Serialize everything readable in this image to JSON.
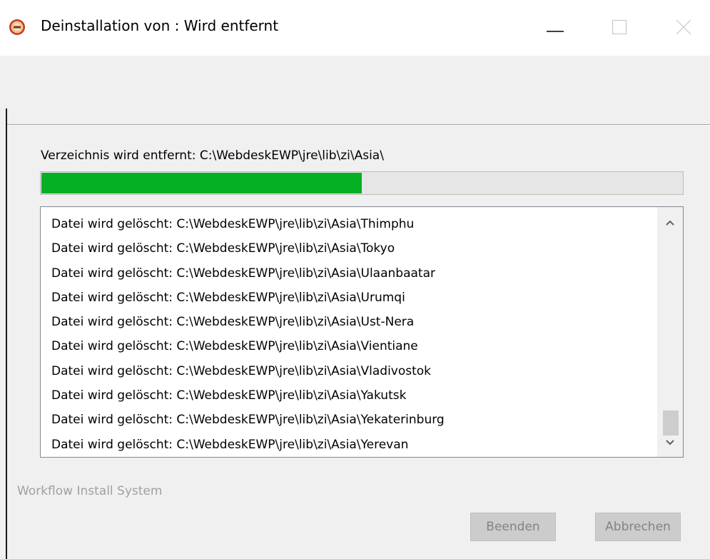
{
  "window": {
    "title": "Deinstallation von : Wird entfernt",
    "icon": "installer-app-icon"
  },
  "titlebar_controls": {
    "minimize_icon": "minimize-icon",
    "maximize_icon": "maximize-icon",
    "close_icon": "close-icon"
  },
  "status": {
    "label": "Verzeichnis wird entfernt: C:\\WebdeskEWP\\jre\\lib\\zi\\Asia\\",
    "progress": 0.5,
    "progress_color": "#06b025"
  },
  "log": {
    "items": [
      "Datei wird gelöscht: C:\\WebdeskEWP\\jre\\lib\\zi\\Asia\\Thimphu",
      "Datei wird gelöscht: C:\\WebdeskEWP\\jre\\lib\\zi\\Asia\\Tokyo",
      "Datei wird gelöscht: C:\\WebdeskEWP\\jre\\lib\\zi\\Asia\\Ulaanbaatar",
      "Datei wird gelöscht: C:\\WebdeskEWP\\jre\\lib\\zi\\Asia\\Urumqi",
      "Datei wird gelöscht: C:\\WebdeskEWP\\jre\\lib\\zi\\Asia\\Ust-Nera",
      "Datei wird gelöscht: C:\\WebdeskEWP\\jre\\lib\\zi\\Asia\\Vientiane",
      "Datei wird gelöscht: C:\\WebdeskEWP\\jre\\lib\\zi\\Asia\\Vladivostok",
      "Datei wird gelöscht: C:\\WebdeskEWP\\jre\\lib\\zi\\Asia\\Yakutsk",
      "Datei wird gelöscht: C:\\WebdeskEWP\\jre\\lib\\zi\\Asia\\Yekaterinburg",
      "Datei wird gelöscht: C:\\WebdeskEWP\\jre\\lib\\zi\\Asia\\Yerevan"
    ],
    "scroll_up_icon": "chevron-up-icon",
    "scroll_down_icon": "chevron-down-icon"
  },
  "footer": {
    "brand": "Workflow Install System",
    "finish_label": "Beenden",
    "cancel_label": "Abbrechen"
  }
}
